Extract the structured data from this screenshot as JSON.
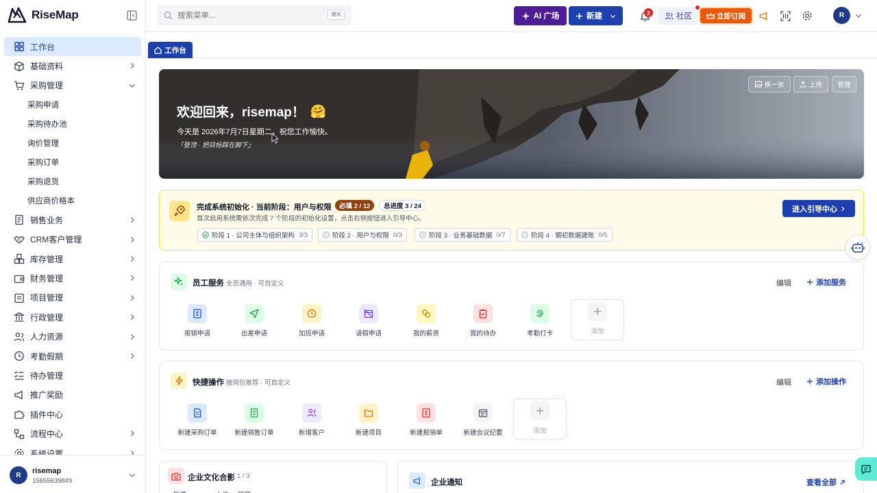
{
  "app": {
    "name": "RiseMap"
  },
  "sidebar": {
    "items": [
      {
        "label": "工作台"
      },
      {
        "label": "基础资料"
      },
      {
        "label": "采购管理"
      },
      {
        "label": "销售业务"
      },
      {
        "label": "CRM客户管理"
      },
      {
        "label": "库存管理"
      },
      {
        "label": "财务管理"
      },
      {
        "label": "项目管理"
      },
      {
        "label": "行政管理"
      },
      {
        "label": "人力资源"
      },
      {
        "label": "考勤假期"
      },
      {
        "label": "待办管理"
      },
      {
        "label": "推广奖励"
      },
      {
        "label": "插件中心"
      },
      {
        "label": "流程中心"
      },
      {
        "label": "系统设置"
      }
    ],
    "purchase_sub": [
      "采购申请",
      "采购待办池",
      "询价管理",
      "采购订单",
      "采购退货",
      "供应商价格本"
    ],
    "user": {
      "initial": "R",
      "name": "risemap",
      "phone": "15655639849"
    }
  },
  "topbar": {
    "search_placeholder": "搜索菜单...",
    "search_shortcut": "⌘K",
    "ai_label": "AI 广场",
    "new_label": "新建",
    "notif_count": "2",
    "community_label": "社区",
    "subscribe_label": "立即订阅",
    "avatar_initial": "R"
  },
  "tabs": [
    {
      "label": "工作台"
    }
  ],
  "hero": {
    "title": "欢迎回来，risemap！",
    "emoji": "🤗",
    "date_text": "今天是 2026年7月7日星期二，祝您工作愉快。",
    "quote": "「登顶 · 把目标踩在脚下」",
    "btn_change": "换一张",
    "btn_upload": "上传",
    "btn_manage": "管理"
  },
  "setup": {
    "title": "完成系统初始化 · 当前阶段：用户与权限",
    "required": "必填 2 / 12",
    "total": "总进度 3 / 24",
    "desc": "首次启用系统需依次完成 7 个阶段的初始化设置，点击右侧按钮进入引导中心。",
    "stages": [
      {
        "label": "阶段 1 · 公司主体与组织架构",
        "count": "3/3"
      },
      {
        "label": "阶段 2 · 用户与权限",
        "count": "0/3"
      },
      {
        "label": "阶段 3 · 业务基础数据",
        "count": "0/7"
      },
      {
        "label": "阶段 4 · 期初数据建账",
        "count": "0/5"
      }
    ],
    "guide_label": "进入引导中心"
  },
  "services": {
    "title": "员工服务",
    "subtitle": "全员通用 · 可自定义",
    "edit_label": "编辑",
    "add_label": "添加服务",
    "tiles": [
      "报销申请",
      "出差申请",
      "加班申请",
      "请假申请",
      "我的薪资",
      "我的待办",
      "考勤打卡"
    ],
    "add_tile": "添加"
  },
  "quick": {
    "title": "快捷操作",
    "subtitle": "按岗位推荐 · 可自定义",
    "edit_label": "编辑",
    "add_label": "添加操作",
    "tiles": [
      "新建采购订单",
      "新建销售订单",
      "新增客户",
      "新建项目",
      "新建报销单",
      "新建会议纪要"
    ],
    "add_tile": "添加"
  },
  "culture": {
    "title": "企业文化合影",
    "count": "1 / 3",
    "btn1": "暂停",
    "btn2": "上传",
    "btn3": "管理"
  },
  "notice": {
    "title": "企业通知",
    "view_all": "查看全部"
  },
  "colors": {
    "primary": "#1e40af",
    "ai": "#4c1d95",
    "subscribe": "#ea580c",
    "setup_bg": "#fefce8"
  }
}
